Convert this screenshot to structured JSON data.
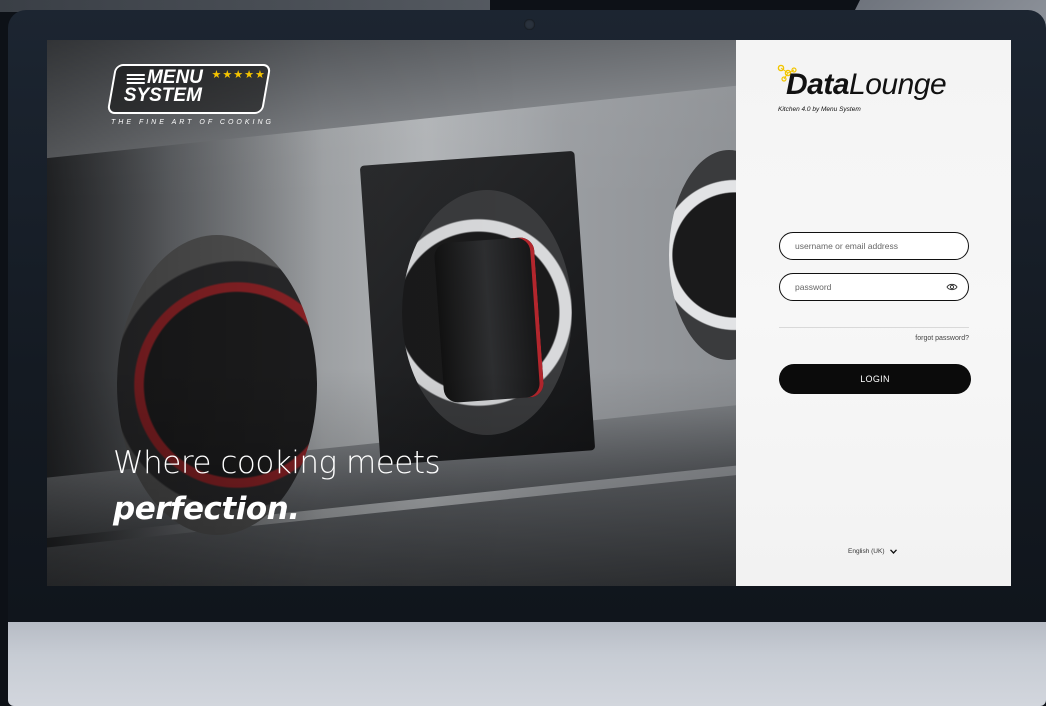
{
  "hero": {
    "brand": {
      "line1": "MENU",
      "line2": "SYSTEM",
      "stars": "★★★★★",
      "tagline": "THE FINE ART OF COOKING"
    },
    "headline": "Where cooking meets",
    "headline_emphasis": "perfection."
  },
  "login": {
    "logo": {
      "word_bold": "Data",
      "word_regular": "Lounge",
      "subtitle": "Kitchen 4.0 by Menu System"
    },
    "username_placeholder": "username or email address",
    "password_placeholder": "password",
    "forgot_label": "forgot password?",
    "login_label": "LOGIN",
    "language": "English (UK)"
  },
  "colors": {
    "accent_star": "#f5c400",
    "button_bg": "#0b0b0b",
    "dots_yellow": "#f2c500"
  },
  "icons": {
    "password_toggle": "eye-icon",
    "language_dropdown": "chevron-down-icon"
  }
}
